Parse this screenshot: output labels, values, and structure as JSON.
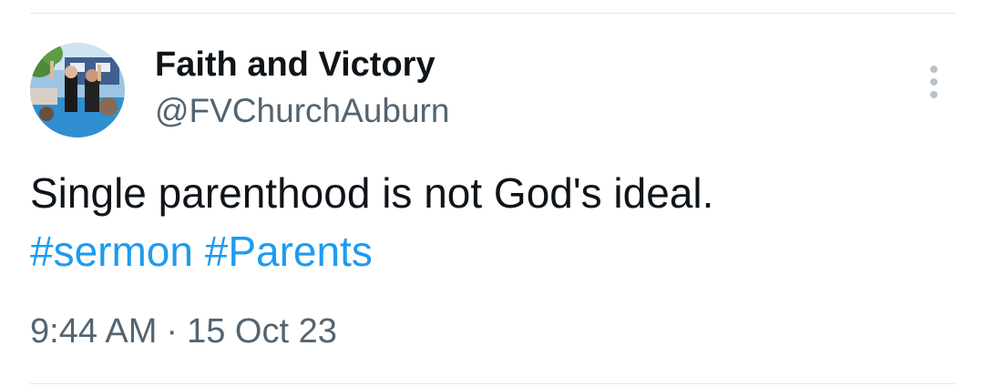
{
  "author": {
    "display_name": "Faith and Victory",
    "handle": "@FVChurchAuburn",
    "avatar_icon": "profile-photo"
  },
  "tweet": {
    "text": "Single parenthood is not God's ideal.",
    "hashtags": [
      "#sermon",
      "#Parents"
    ]
  },
  "meta": {
    "time": "9:44 AM",
    "separator": "·",
    "date": "15 Oct 23"
  },
  "menu": {
    "icon": "more-vertical-icon"
  },
  "colors": {
    "text_primary": "#0f1419",
    "text_secondary": "#536471",
    "link": "#1d9bf0",
    "divider": "#e4e8eb"
  }
}
